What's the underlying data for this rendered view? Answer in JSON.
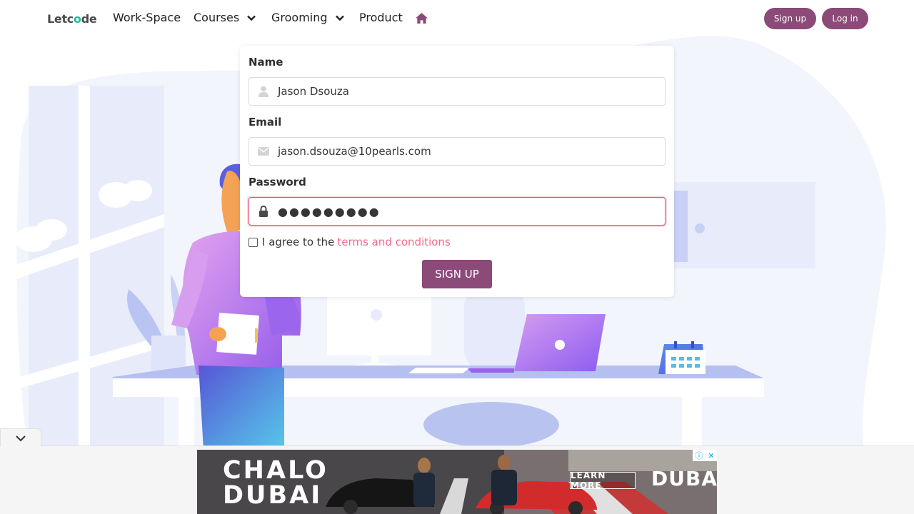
{
  "nav": {
    "logo_pre": "Let",
    "logo_mid": "c",
    "logo_o": "o",
    "logo_post": "de",
    "items": [
      {
        "label": "Work-Space"
      },
      {
        "label": "Courses"
      },
      {
        "label": "Grooming"
      },
      {
        "label": "Product"
      }
    ],
    "signup_label": "Sign up",
    "login_label": "Log in"
  },
  "form": {
    "name_label": "Name",
    "name_value": "Jason Dsouza",
    "email_label": "Email",
    "email_value": "jason.dsouza@10pearls.com",
    "password_label": "Password",
    "password_value": "●●●●●●●●●",
    "agree_text": "I agree to the",
    "terms_link": "terms and conditions",
    "submit_label": "SIGN UP"
  },
  "ad": {
    "headline_line1": "CHALO",
    "headline_line2": "DUBAI",
    "cta_label": "LEARN MORE",
    "brand": "DUBAI"
  },
  "colors": {
    "brand": "#8b4a77",
    "link": "#f16a8a",
    "danger": "#f14668",
    "logo_accent": "#1bbf9a"
  }
}
